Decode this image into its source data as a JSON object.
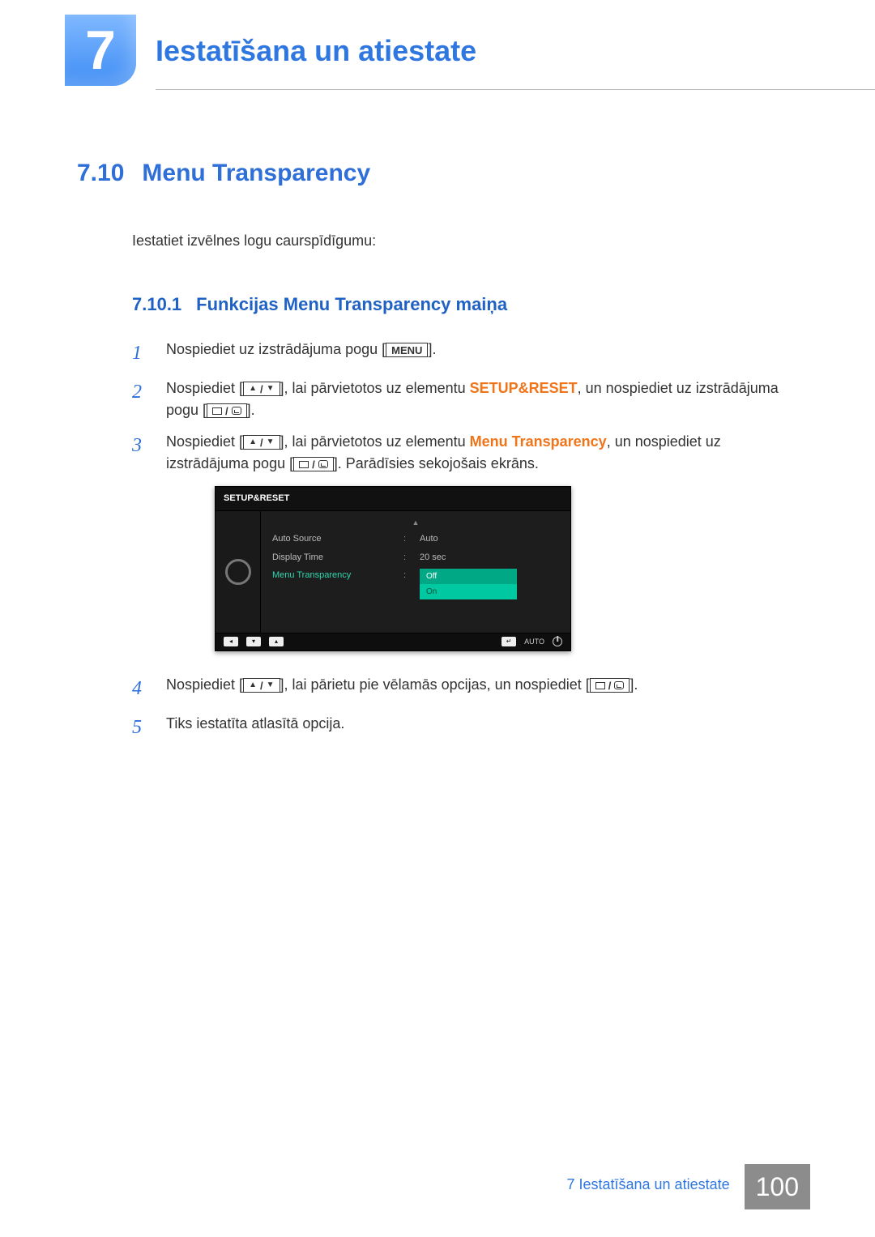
{
  "chapter": {
    "number": "7",
    "title": "Iestatīšana un atiestate"
  },
  "section": {
    "number": "7.10",
    "title": "Menu Transparency"
  },
  "intro": "Iestatiet izvēlnes logu caurspīdīgumu:",
  "subsection": {
    "number": "7.10.1",
    "title": "Funkcijas Menu Transparency maiņa"
  },
  "steps": {
    "s1": {
      "pre": "Nospiediet uz izstrādājuma pogu [",
      "menu": "MENU",
      "post": "]."
    },
    "s2": {
      "pre": "Nospiediet [",
      "mid1": "], lai pārvietotos uz elementu ",
      "kw": "SETUP&RESET",
      "mid2": ", un nospiediet uz izstrādājuma pogu [",
      "post": "]."
    },
    "s3": {
      "pre": "Nospiediet [",
      "mid1": "], lai pārvietotos uz elementu ",
      "kw": "Menu Transparency",
      "mid2": ", un nospiediet uz izstrādājuma pogu [",
      "post": "]. Parādīsies sekojošais ekrāns."
    },
    "s4": {
      "pre": "Nospiediet [",
      "mid1": "], lai pārietu pie vēlamās opcijas, un nospiediet [",
      "post": "]."
    },
    "s5": "Tiks iestatīta atlasītā opcija."
  },
  "osd": {
    "title": "SETUP&RESET",
    "rows": {
      "r1": {
        "label": "Auto Source",
        "value": "Auto"
      },
      "r2": {
        "label": "Display Time",
        "value": "20 sec"
      },
      "r3": {
        "label": "Menu Transparency",
        "opts": {
          "o1": "Off",
          "o2": "On"
        }
      }
    },
    "footer": {
      "auto": "AUTO"
    }
  },
  "footer": {
    "label": "7 Iestatīšana un atiestate",
    "page": "100"
  }
}
